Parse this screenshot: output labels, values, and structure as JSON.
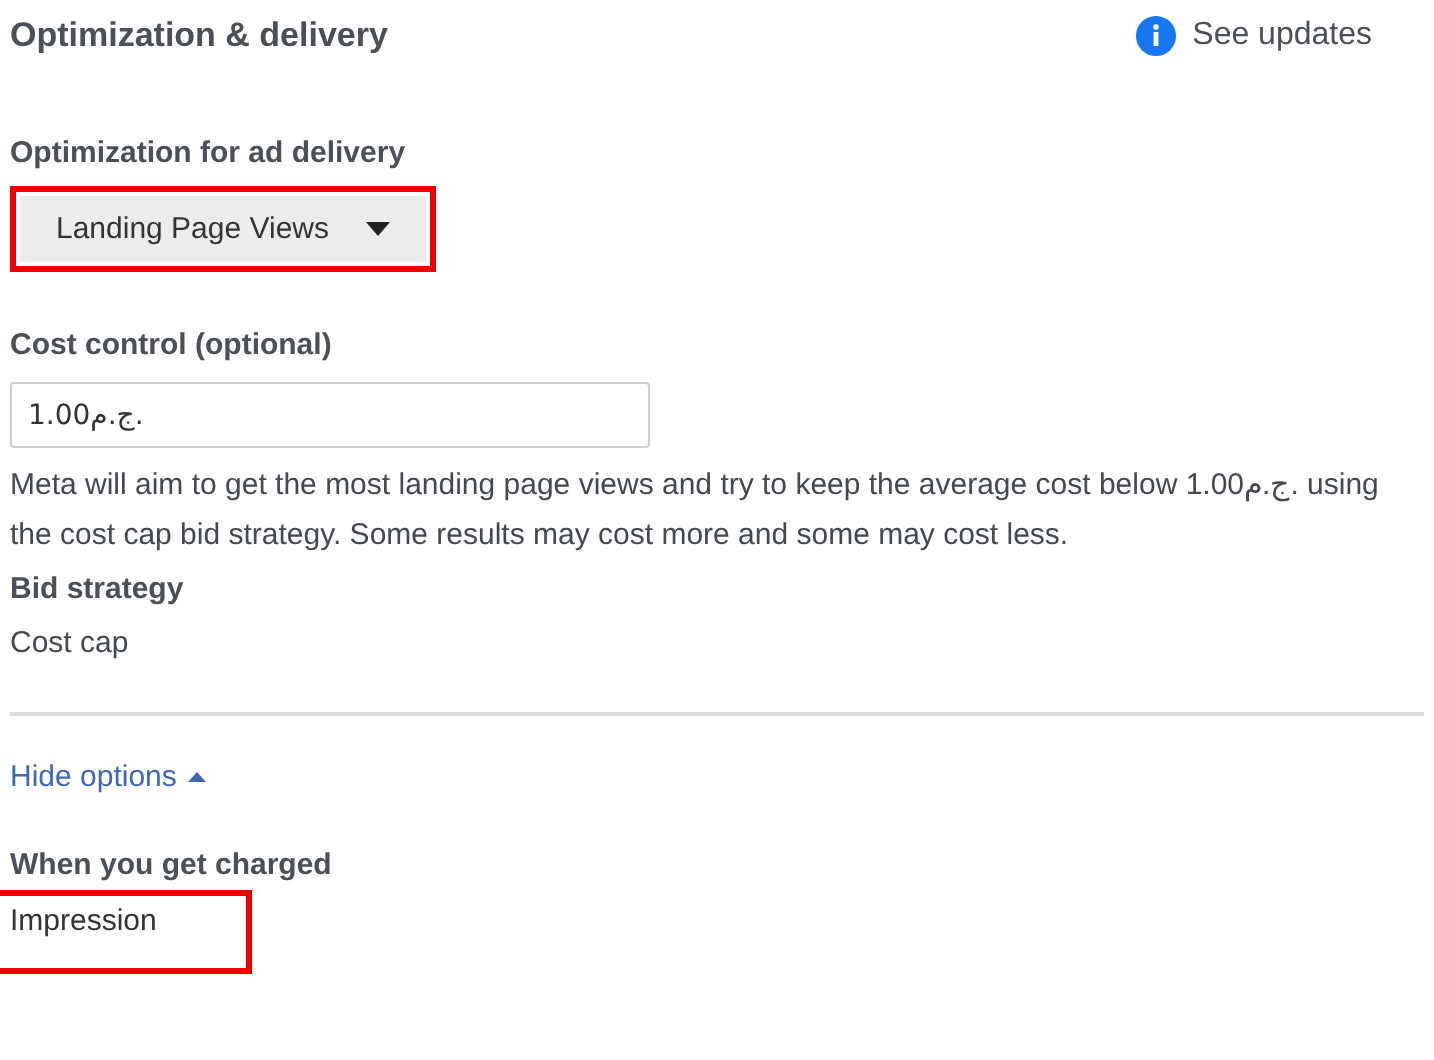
{
  "section": {
    "title": "Optimization & delivery",
    "updates_link": "See updates"
  },
  "optimization": {
    "label": "Optimization for ad delivery",
    "value": "Landing Page Views",
    "highlighted": true
  },
  "cost_control": {
    "label": "Cost control (optional)",
    "value": "1.00ج.م.",
    "description": "Meta will aim to get the most landing page views and try to keep the average cost below 1.00ج.م. using the cost cap bid strategy. Some results may cost more and some may cost less."
  },
  "bid_strategy": {
    "label": "Bid strategy",
    "value": "Cost cap"
  },
  "toggle": {
    "label": "Hide options",
    "expanded": true
  },
  "charged": {
    "label": "When you get charged",
    "value": "Impression",
    "highlighted": true
  }
}
